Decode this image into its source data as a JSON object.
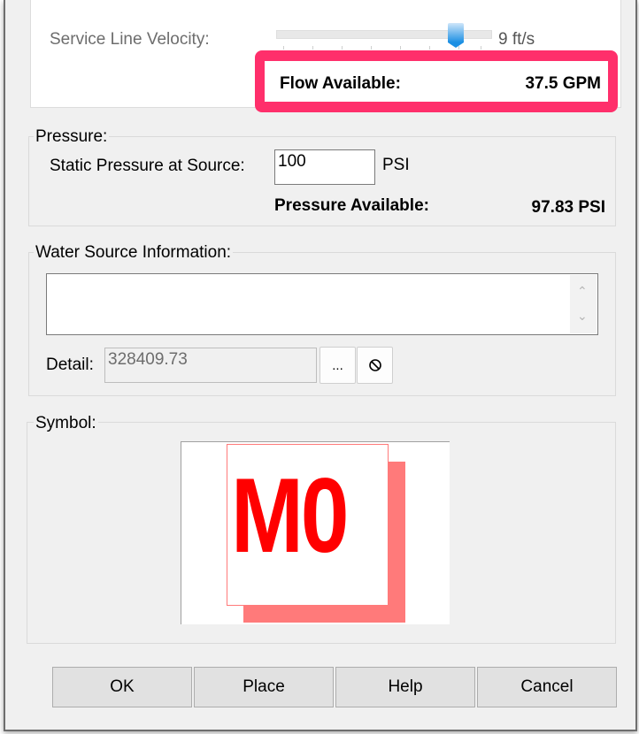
{
  "flow": {
    "velocity_label": "Service Line Velocity:",
    "velocity_value": "9 ft/s",
    "velocity_slider_position_fraction": 0.83,
    "flow_available_label": "Flow Available:",
    "flow_available_value": "37.5 GPM"
  },
  "highlight_color": "#ff2f6b",
  "pressure": {
    "group_label": "Pressure:",
    "static_label": "Static Pressure at Source:",
    "static_value": "100",
    "static_unit": "PSI",
    "available_label": "Pressure Available:",
    "available_value": "97.83 PSI"
  },
  "water_source": {
    "group_label": "Water Source Information:",
    "info_text": "",
    "detail_label": "Detail:",
    "detail_value": "328409.73",
    "browse_label": "...",
    "clear_icon": "no-symbol-icon"
  },
  "symbol": {
    "group_label": "Symbol:",
    "text": "M0",
    "text_color": "#ff0000",
    "shadow_color": "#ff7a7a"
  },
  "buttons": {
    "ok": "OK",
    "place": "Place",
    "help": "Help",
    "cancel": "Cancel"
  }
}
